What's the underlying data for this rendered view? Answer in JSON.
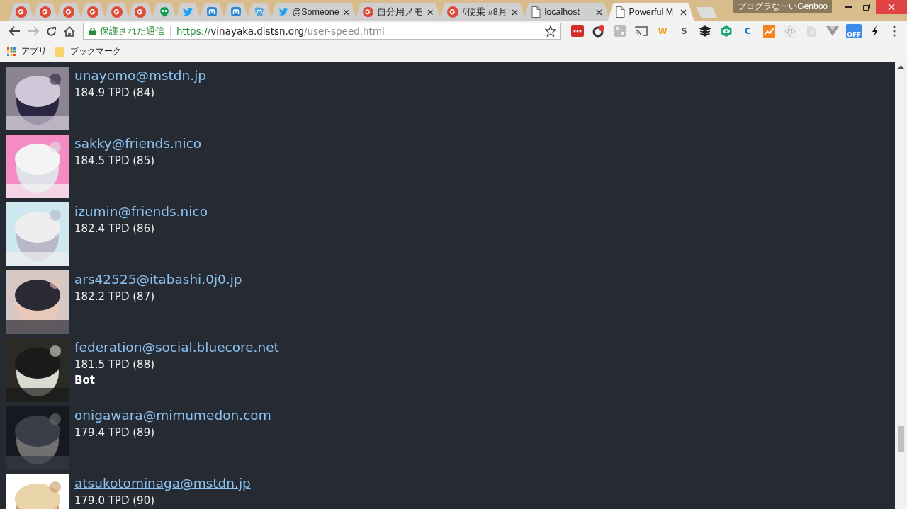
{
  "tabs": [
    {
      "kind": "gplus",
      "selected": false
    },
    {
      "kind": "gplus",
      "selected": false
    },
    {
      "kind": "gplus",
      "selected": false
    },
    {
      "kind": "gplus",
      "selected": false
    },
    {
      "kind": "gplus",
      "selected": false
    },
    {
      "kind": "gplus",
      "selected": false
    },
    {
      "kind": "hangouts",
      "selected": false
    },
    {
      "kind": "twitter",
      "selected": false
    },
    {
      "kind": "mastodon",
      "selected": false
    },
    {
      "kind": "mastodon",
      "selected": false
    },
    {
      "kind": "mastodon-alt",
      "selected": false
    },
    {
      "kind": "twitter",
      "title": "@Someone",
      "selected": false
    },
    {
      "kind": "gplus",
      "title": "自分用メモ",
      "selected": false
    },
    {
      "kind": "gplus",
      "title": "#便乗 #8月",
      "selected": false
    },
    {
      "kind": "page",
      "title": "localhost",
      "selected": false
    },
    {
      "kind": "page",
      "title": "Powerful M",
      "selected": true
    }
  ],
  "profile": "プログラなーいGenboo",
  "address_bar": {
    "security": "保護された通信",
    "scheme": "https://",
    "host": "vinayaka.distsn.org",
    "path": "/user-speed.html"
  },
  "extensions": [
    {
      "kind": "lastpass"
    },
    {
      "kind": "badge-circle"
    },
    {
      "kind": "gplus-grey"
    },
    {
      "kind": "cast"
    },
    {
      "kind": "letter",
      "glyph": "W",
      "color": "#f0a020"
    },
    {
      "kind": "letter",
      "glyph": "S",
      "color": "#555555"
    },
    {
      "kind": "layers"
    },
    {
      "kind": "eye"
    },
    {
      "kind": "letter",
      "glyph": "C",
      "color": "#1a73c8"
    },
    {
      "kind": "chart"
    },
    {
      "kind": "atom"
    },
    {
      "kind": "doc"
    },
    {
      "kind": "vee"
    },
    {
      "kind": "off-badge",
      "label": "OFF"
    },
    {
      "kind": "bolt"
    }
  ],
  "bookmarks": [
    {
      "kind": "apps",
      "label": "アプリ"
    },
    {
      "kind": "folder",
      "label": "ブックマーク"
    }
  ],
  "users": [
    {
      "account": "unayomo@mstdn.jp",
      "stats": "184.9 TPD (84)"
    },
    {
      "account": "sakky@friends.nico",
      "stats": "184.5 TPD (85)"
    },
    {
      "account": "izumin@friends.nico",
      "stats": "182.4 TPD (86)"
    },
    {
      "account": "ars42525@itabashi.0j0.jp",
      "stats": "182.2 TPD (87)"
    },
    {
      "account": "federation@social.bluecore.net",
      "stats": "181.5 TPD (88)",
      "badge": "Bot"
    },
    {
      "account": "onigawara@mimumedon.com",
      "stats": "179.4 TPD (89)"
    },
    {
      "account": "atsukotominaga@mstdn.jp",
      "stats": "179.0 TPD (90)"
    }
  ]
}
